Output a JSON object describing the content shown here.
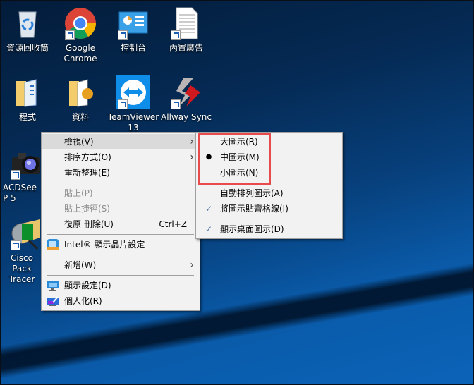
{
  "desktop_icons": [
    {
      "name": "recycle-bin",
      "label": "資源回收筒"
    },
    {
      "name": "google-chrome",
      "label": "Google Chrome"
    },
    {
      "name": "control-panel",
      "label": "控制台"
    },
    {
      "name": "builtin-ads",
      "label": "內置廣告"
    },
    {
      "name": "programs-folder",
      "label": "程式"
    },
    {
      "name": "data-folder",
      "label": "資料"
    },
    {
      "name": "teamviewer",
      "label": "TeamViewer 13"
    },
    {
      "name": "allway-sync",
      "label": "Allway Sync"
    },
    {
      "name": "acdsee",
      "label": "ACDSee P 5"
    },
    {
      "name": "cisco-packet-tracer",
      "label": "Cisco Pack Tracer"
    }
  ],
  "context_menu": {
    "items": [
      {
        "label": "檢視(V)",
        "submenu": true,
        "highlighted": true
      },
      {
        "label": "排序方式(O)",
        "submenu": true
      },
      {
        "label": "重新整理(E)"
      },
      {
        "label": "貼上(P)",
        "disabled": true
      },
      {
        "label": "貼上捷徑(S)",
        "disabled": true
      },
      {
        "label": "復原 刪除(U)",
        "shortcut": "Ctrl+Z"
      },
      {
        "label": "Intel® 顯示晶片設定",
        "icon": "intel-graphics-icon"
      },
      {
        "label": "新增(W)",
        "submenu": true
      },
      {
        "label": "顯示設定(D)",
        "icon": "display-settings-icon"
      },
      {
        "label": "個人化(R)",
        "icon": "personalize-icon"
      }
    ]
  },
  "view_submenu": {
    "items": [
      {
        "label": "大圖示(R)"
      },
      {
        "label": "中圖示(M)",
        "mark": "●"
      },
      {
        "label": "小圖示(N)"
      },
      {
        "label": "自動排列圖示(A)"
      },
      {
        "label": "將圖示貼齊格線(I)",
        "mark": "✓"
      },
      {
        "label": "顯示桌面圖示(D)",
        "mark": "✓"
      }
    ]
  },
  "colors": {
    "highlight_box": "#e84b4b",
    "menu_bg": "#f2f2f2"
  }
}
